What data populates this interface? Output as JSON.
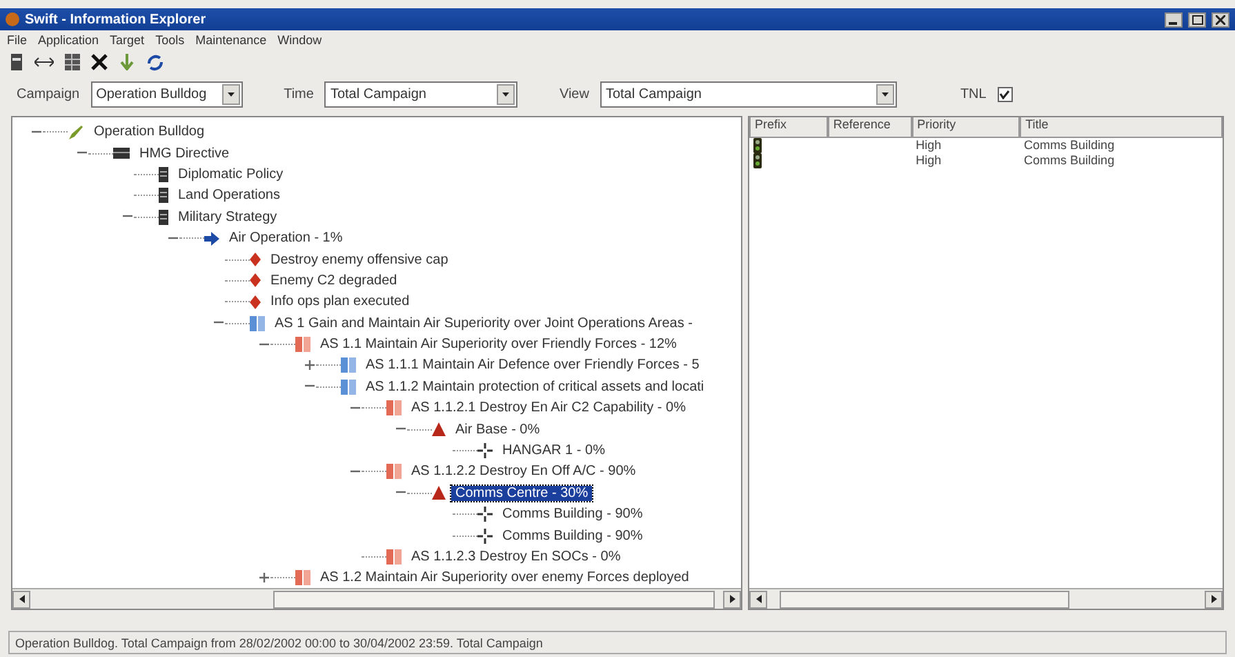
{
  "window": {
    "title": "Swift - Information Explorer"
  },
  "menu": [
    "File",
    "Application",
    "Target",
    "Tools",
    "Maintenance",
    "Window"
  ],
  "toolbar": [
    {
      "kind": "doc"
    },
    {
      "kind": "arrows"
    },
    {
      "kind": "grid"
    },
    {
      "kind": "delete"
    },
    {
      "kind": "down"
    },
    {
      "kind": "refresh"
    }
  ],
  "filters": [
    {
      "label": "Campaign",
      "value": "Operation Bulldog"
    },
    {
      "label": "Time",
      "value": "Total Campaign"
    },
    {
      "label": "View",
      "value": "Total Campaign"
    }
  ],
  "tnl": {
    "label": "TNL",
    "checked": true
  },
  "tree": [
    {
      "label": "Operation Bulldog",
      "kind": "pencil",
      "expanded": true,
      "selected": false,
      "children": [
        {
          "label": "HMG Directive",
          "kind": "block",
          "expanded": true,
          "selected": false,
          "children": [
            {
              "label": "Diplomatic Policy",
              "kind": "doc",
              "selected": false
            },
            {
              "label": "Land Operations",
              "kind": "doc",
              "selected": false
            },
            {
              "label": "Military Strategy",
              "kind": "doc",
              "expanded": true,
              "selected": false,
              "children": [
                {
                  "label": "Air Operation - 1%",
                  "kind": "arrow",
                  "expanded": true,
                  "selected": false,
                  "children": [
                    {
                      "label": "Destroy enemy offensive cap",
                      "kind": "diamond",
                      "selected": false
                    },
                    {
                      "label": "Enemy C2 degraded",
                      "kind": "diamond",
                      "selected": false
                    },
                    {
                      "label": "Info ops plan executed",
                      "kind": "diamond",
                      "selected": false
                    },
                    {
                      "label": "AS 1 Gain and Maintain Air Superiority over Joint Operations Areas -",
                      "kind": "blue-objective",
                      "expanded": true,
                      "selected": false,
                      "children": [
                        {
                          "label": "AS 1.1 Maintain Air Superiority over Friendly Forces - 12%",
                          "kind": "red-objective",
                          "expanded": true,
                          "selected": false,
                          "children": [
                            {
                              "label": "AS 1.1.1 Maintain Air Defence over Friendly Forces - 5",
                              "kind": "blue-objective",
                              "expanded": false,
                              "selected": false
                            },
                            {
                              "label": "AS 1.1.2 Maintain protection of critical assets and locati",
                              "kind": "blue-objective",
                              "expanded": true,
                              "selected": false,
                              "children": [
                                {
                                  "label": "AS 1.1.2.1 Destroy En Air C2 Capability - 0%",
                                  "kind": "red-objective",
                                  "expanded": true,
                                  "selected": false,
                                  "children": [
                                    {
                                      "label": "Air Base - 0%",
                                      "kind": "triangle",
                                      "expanded": true,
                                      "selected": false,
                                      "children": [
                                        {
                                          "label": "HANGAR 1 - 0%",
                                          "kind": "crosshair",
                                          "selected": false
                                        }
                                      ]
                                    }
                                  ]
                                },
                                {
                                  "label": "AS 1.1.2.2 Destroy En Off A/C - 90%",
                                  "kind": "red-objective",
                                  "expanded": true,
                                  "selected": false,
                                  "children": [
                                    {
                                      "label": "Comms Centre - 30%",
                                      "kind": "triangle",
                                      "expanded": true,
                                      "selected": true,
                                      "children": [
                                        {
                                          "label": "Comms Building - 90%",
                                          "kind": "crosshair",
                                          "selected": false
                                        },
                                        {
                                          "label": "Comms Building - 90%",
                                          "kind": "crosshair",
                                          "selected": false
                                        }
                                      ]
                                    }
                                  ]
                                },
                                {
                                  "label": "AS 1.1.2.3 Destroy En SOCs - 0%",
                                  "kind": "red-objective",
                                  "selected": false
                                }
                              ]
                            }
                          ]
                        },
                        {
                          "label": "AS 1.2 Maintain Air Superiority over enemy Forces deployed",
                          "kind": "red-objective",
                          "expanded": false,
                          "selected": false
                        }
                      ]
                    }
                  ]
                }
              ]
            }
          ]
        }
      ]
    }
  ],
  "table": {
    "columns": [
      "Prefix",
      "Reference",
      "Priority",
      "Title"
    ],
    "rows": [
      {
        "kind": "traffic-light",
        "priority": "High",
        "title": "Comms Building"
      },
      {
        "kind": "traffic-light",
        "priority": "High",
        "title": "Comms Building"
      }
    ]
  },
  "status_bar": "Operation Bulldog.  Total Campaign from 28/02/2002 00:00 to 30/04/2002 23:59.  Total Campaign"
}
